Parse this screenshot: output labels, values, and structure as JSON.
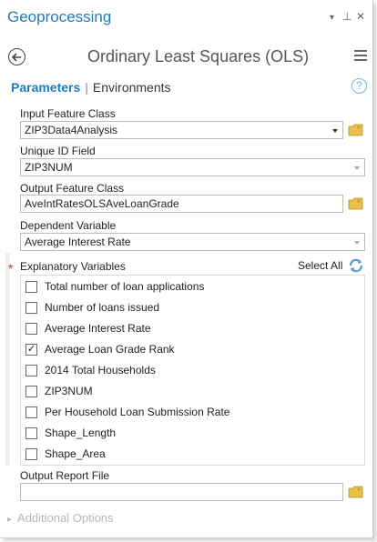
{
  "pane": {
    "title": "Geoprocessing",
    "controls": {
      "menu": "▾",
      "pin": "⊥",
      "close": "✕"
    }
  },
  "tool": {
    "title": "Ordinary Least Squares (OLS)"
  },
  "tabs": {
    "active": "Parameters",
    "inactive": "Environments"
  },
  "help": {
    "symbol": "?"
  },
  "params": {
    "input_feature_class": {
      "label": "Input Feature Class",
      "value": "ZIP3Data4Analysis"
    },
    "unique_id_field": {
      "label": "Unique ID Field",
      "value": "ZIP3NUM"
    },
    "output_feature_class": {
      "label": "Output Feature Class",
      "value": "AveIntRatesOLSAveLoanGrade"
    },
    "dependent_variable": {
      "label": "Dependent Variable",
      "value": "Average Interest Rate"
    },
    "explanatory_variables": {
      "required_marker": "*",
      "label": "Explanatory Variables",
      "select_all": "Select All",
      "items": [
        {
          "label": "Total number of loan applications",
          "checked": false
        },
        {
          "label": "Number of loans issued",
          "checked": false
        },
        {
          "label": "Average Interest Rate",
          "checked": false
        },
        {
          "label": "Average Loan Grade Rank",
          "checked": true
        },
        {
          "label": "2014 Total Households",
          "checked": false
        },
        {
          "label": "ZIP3NUM",
          "checked": false
        },
        {
          "label": "Per Household Loan Submission Rate",
          "checked": false
        },
        {
          "label": "Shape_Length",
          "checked": false
        },
        {
          "label": "Shape_Area",
          "checked": false
        }
      ]
    },
    "output_report_file": {
      "label": "Output Report File",
      "value": ""
    }
  },
  "additional_options": {
    "label": "Additional Options"
  },
  "colors": {
    "accent": "#1e7cbd",
    "required": "#c0392b",
    "folder": "#e8c04a"
  }
}
